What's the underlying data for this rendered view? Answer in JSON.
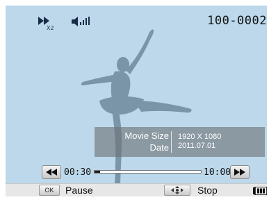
{
  "status_bar": {
    "file_number": "100-0002",
    "speed_icon": "speed-x2-icon",
    "volume_icon": "volume-level-icon",
    "speed_label": "X2"
  },
  "info": {
    "rows": [
      {
        "label": "Movie Size",
        "value": "1920 X 1080"
      },
      {
        "label": "Date",
        "value": "2011.07.01"
      }
    ]
  },
  "playback": {
    "elapsed": "00:30",
    "total": "10:00",
    "progress": 0.05,
    "rewind_icon": "rewind-icon",
    "fast_forward_icon": "fast-forward-icon"
  },
  "controls": {
    "ok_key": "OK",
    "ok_label": "Pause",
    "nav_icon": "dpad-icon",
    "stop_label": "Stop",
    "battery_icon": "battery-icon"
  },
  "colors": {
    "screen_bg": "#bcd8ea",
    "silhouette": "#7a94a8",
    "overlay": "#6e7378"
  }
}
